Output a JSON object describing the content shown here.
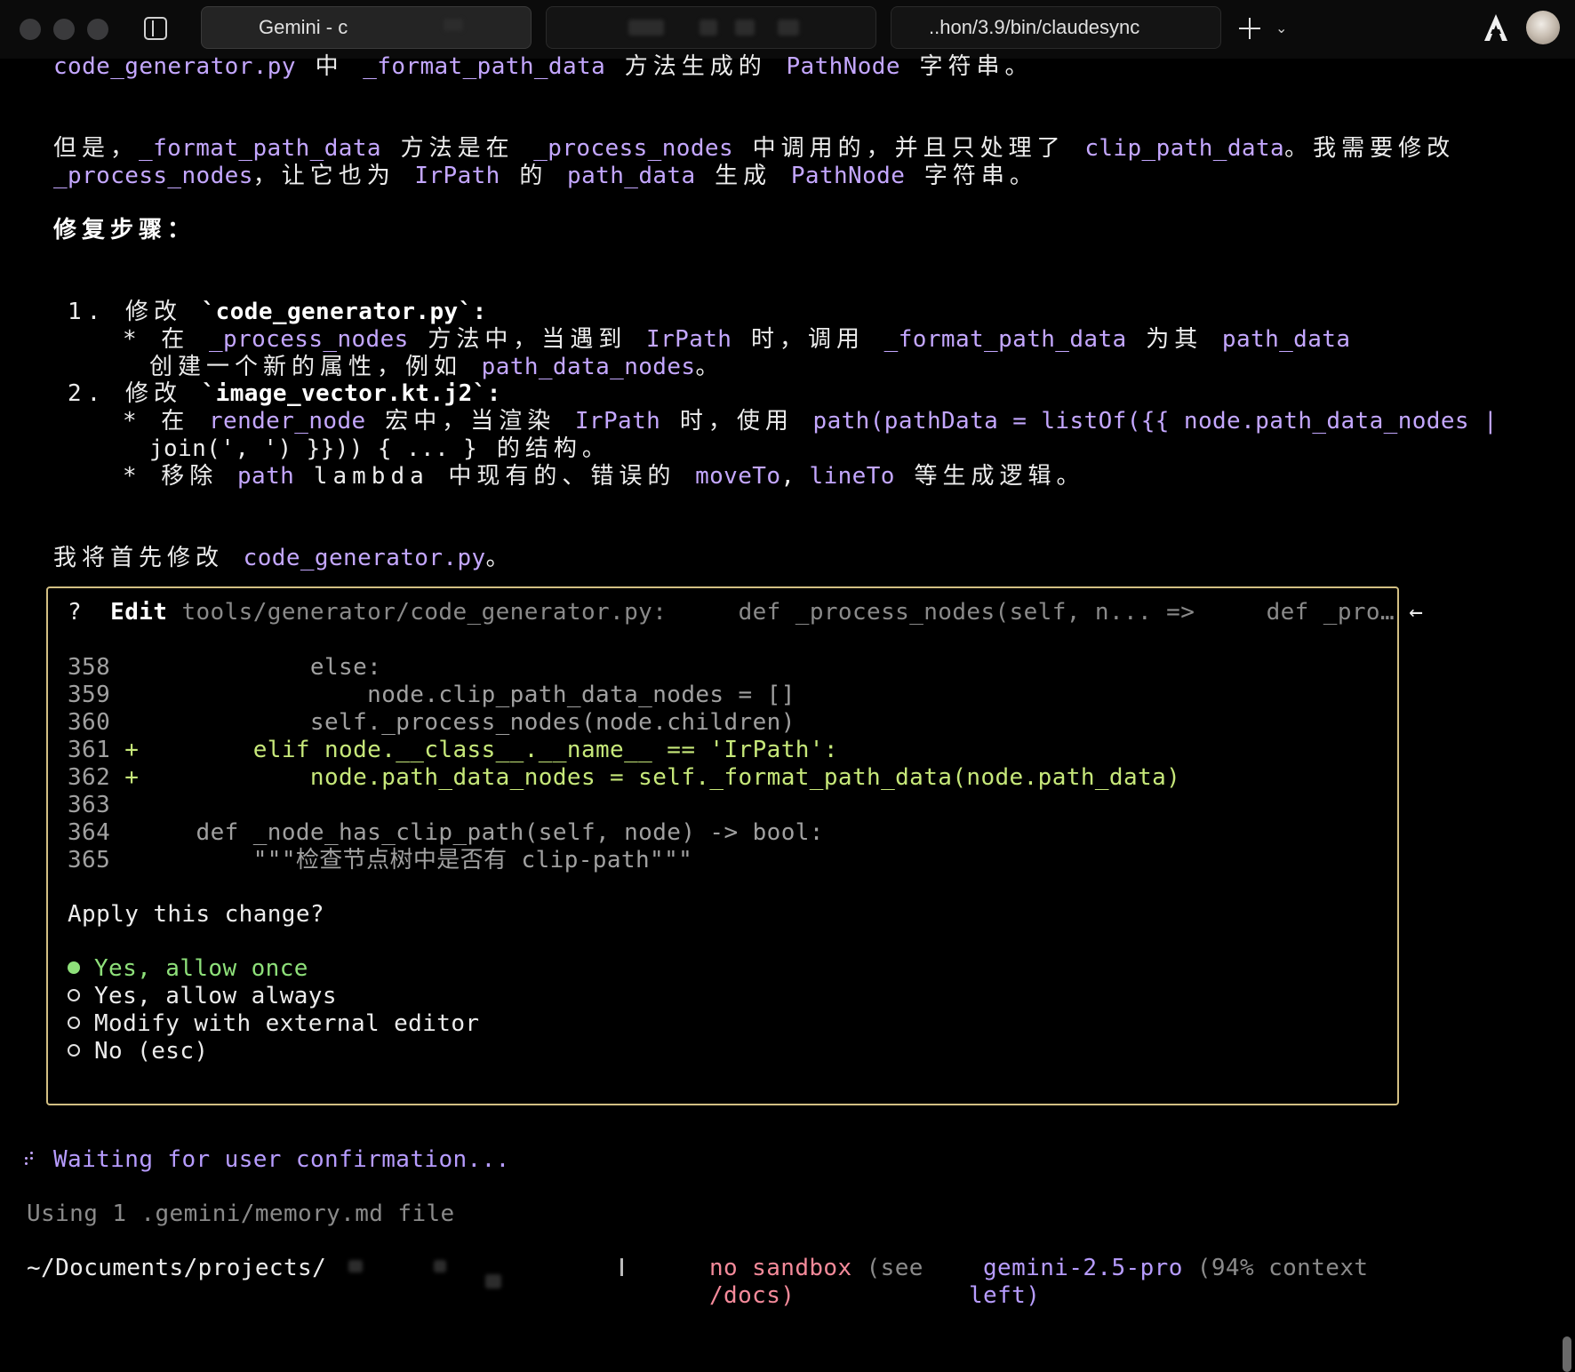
{
  "titlebar": {
    "tabs": [
      {
        "label": "Gemini - c",
        "active": true
      },
      {
        "label": "",
        "active": false
      },
      {
        "label": "..hon/3.9/bin/claudesync",
        "active": false
      }
    ]
  },
  "message": {
    "line1": {
      "a": "code_generator.py",
      "b": " 中 ",
      "c": "_format_path_data",
      "d": " 方法生成的 ",
      "e": "PathNode",
      "f": " 字符串。"
    },
    "para2": {
      "l1a": "但是，",
      "l1b": "_format_path_data",
      "l1c": " 方法是在 ",
      "l1d": "_process_nodes",
      "l1e": " 中调用的，并且只处理了 ",
      "l1f": "clip_path_data",
      "l1g": "。我需要修改",
      "l2a": "_process_nodes",
      "l2b": "，让它也为 ",
      "l2c": "IrPath",
      "l2d": " 的 ",
      "l2e": "path_data",
      "l2f": " 生成 ",
      "l2g": "PathNode",
      "l2h": " 字符串。"
    },
    "steps_heading": "修复步骤：",
    "step1": {
      "title_a": "1. 修改 ",
      "title_b": "`code_generator.py`",
      "title_c": ":",
      "b1a": "* 在 ",
      "b1b": "_process_nodes",
      "b1c": " 方法中，当遇到 ",
      "b1d": "IrPath",
      "b1e": " 时，调用 ",
      "b1f": "_format_path_data",
      "b1g": " 为其 ",
      "b1h": "path_data",
      "b1i": "创建一个新的属性，例如 ",
      "b1j": "path_data_nodes",
      "b1k": "。"
    },
    "step2": {
      "title_a": "2. 修改 ",
      "title_b": "`image_vector.kt.j2`",
      "title_c": ":",
      "b1a": "* 在 ",
      "b1b": "render_node",
      "b1c": " 宏中，当渲染 ",
      "b1d": "IrPath",
      "b1e": " 时，使用 ",
      "b1f": "path(pathData = listOf({{ node.path_data_nodes |",
      "b1g": "join(', ') }})) { ... }",
      "b1h": " 的结构。",
      "b2a": "* 移除 ",
      "b2b": "path",
      "b2c": " lambda 中现有的、错误的 ",
      "b2d": "moveTo",
      "b2e": ", ",
      "b2f": "lineTo",
      "b2g": " 等生成逻辑。"
    },
    "closing_a": "我将首先修改 ",
    "closing_b": "code_generator.py",
    "closing_c": "。"
  },
  "edit": {
    "marker": "?",
    "action": "Edit",
    "path": "tools/generator/code_generator.py:",
    "from": "def _process_nodes(self, n... =>",
    "to": "def _pro…",
    "arrow": "←",
    "lines": [
      {
        "num": "358",
        "sign": " ",
        "code": "            else:",
        "added": false
      },
      {
        "num": "359",
        "sign": " ",
        "code": "                node.clip_path_data_nodes = []",
        "added": false
      },
      {
        "num": "360",
        "sign": " ",
        "code": "            self._process_nodes(node.children)",
        "added": false
      },
      {
        "num": "361",
        "sign": "+",
        "code": "        elif node.__class__.__name__ == 'IrPath':",
        "added": true
      },
      {
        "num": "362",
        "sign": "+",
        "code": "            node.path_data_nodes = self._format_path_data(node.path_data)",
        "added": true
      },
      {
        "num": "363",
        "sign": " ",
        "code": "",
        "added": false
      },
      {
        "num": "364",
        "sign": " ",
        "code": "    def _node_has_clip_path(self, node) -> bool:",
        "added": false
      },
      {
        "num": "365",
        "sign": " ",
        "code": "        \"\"\"检查节点树中是否有 clip-path\"\"\"",
        "added": false
      }
    ],
    "question": "Apply this change?",
    "options": [
      {
        "label": "Yes, allow once",
        "selected": true
      },
      {
        "label": "Yes, allow always",
        "selected": false
      },
      {
        "label": "Modify with external editor",
        "selected": false
      },
      {
        "label": "No (esc)",
        "selected": false
      }
    ]
  },
  "status": {
    "waiting": "Waiting for user confirmation...",
    "memory": "Using 1 .gemini/memory.md file",
    "cwd": "~/Documents/projects/",
    "sandbox_a": "no sandbox",
    "sandbox_b": " (see",
    "sandbox_c": "/docs)",
    "model_a": "gemini-2.5-pro",
    "model_b": " (94% context",
    "model_c": "left)"
  },
  "colors": {
    "accent_purple": "#c4a7ff",
    "added_green": "#c7e87a",
    "border_gold": "#d2bf83",
    "warn_red": "#f48a9a"
  }
}
